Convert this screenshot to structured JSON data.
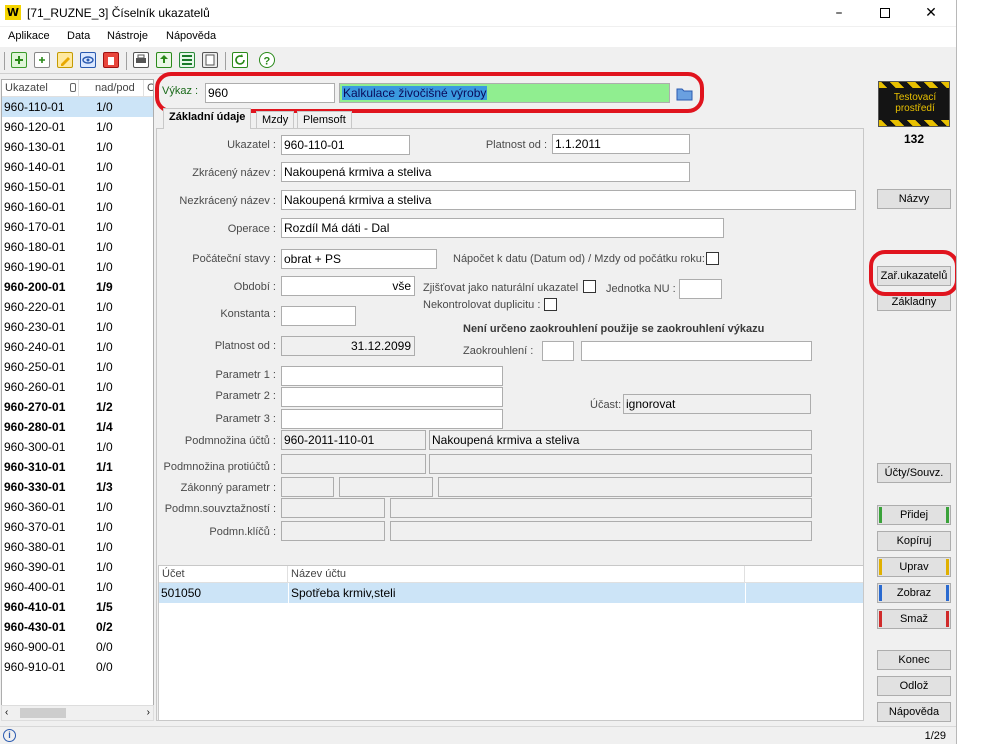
{
  "window": {
    "title": "[71_RUZNE_3] Číselník ukazatelů",
    "app_logo": "W"
  },
  "menu": [
    "Aplikace",
    "Data",
    "Nástroje",
    "Nápověda"
  ],
  "list": {
    "col1": "Ukazatel",
    "col2": "nad/pod",
    "col3": "C",
    "rows": [
      {
        "code": "960-110-01",
        "val": "1/0",
        "bold": false,
        "sel": true
      },
      {
        "code": "960-120-01",
        "val": "1/0",
        "bold": false
      },
      {
        "code": "960-130-01",
        "val": "1/0",
        "bold": false
      },
      {
        "code": "960-140-01",
        "val": "1/0",
        "bold": false
      },
      {
        "code": "960-150-01",
        "val": "1/0",
        "bold": false
      },
      {
        "code": "960-160-01",
        "val": "1/0",
        "bold": false
      },
      {
        "code": "960-170-01",
        "val": "1/0",
        "bold": false
      },
      {
        "code": "960-180-01",
        "val": "1/0",
        "bold": false
      },
      {
        "code": "960-190-01",
        "val": "1/0",
        "bold": false
      },
      {
        "code": "960-200-01",
        "val": "1/9",
        "bold": true
      },
      {
        "code": "960-220-01",
        "val": "1/0",
        "bold": false
      },
      {
        "code": "960-230-01",
        "val": "1/0",
        "bold": false
      },
      {
        "code": "960-240-01",
        "val": "1/0",
        "bold": false
      },
      {
        "code": "960-250-01",
        "val": "1/0",
        "bold": false
      },
      {
        "code": "960-260-01",
        "val": "1/0",
        "bold": false
      },
      {
        "code": "960-270-01",
        "val": "1/2",
        "bold": true
      },
      {
        "code": "960-280-01",
        "val": "1/4",
        "bold": true
      },
      {
        "code": "960-300-01",
        "val": "1/0",
        "bold": false
      },
      {
        "code": "960-310-01",
        "val": "1/1",
        "bold": true
      },
      {
        "code": "960-330-01",
        "val": "1/3",
        "bold": true
      },
      {
        "code": "960-360-01",
        "val": "1/0",
        "bold": false
      },
      {
        "code": "960-370-01",
        "val": "1/0",
        "bold": false
      },
      {
        "code": "960-380-01",
        "val": "1/0",
        "bold": false
      },
      {
        "code": "960-390-01",
        "val": "1/0",
        "bold": false
      },
      {
        "code": "960-400-01",
        "val": "1/0",
        "bold": false
      },
      {
        "code": "960-410-01",
        "val": "1/5",
        "bold": true
      },
      {
        "code": "960-430-01",
        "val": "0/2",
        "bold": true
      },
      {
        "code": "960-900-01",
        "val": "0/0",
        "bold": false
      },
      {
        "code": "960-910-01",
        "val": "0/0",
        "bold": false
      }
    ]
  },
  "vykaz": {
    "label": "Výkaz :",
    "code": "960",
    "name": "Kalkulace živočišné výroby"
  },
  "tabs": [
    "Základní údaje",
    "Mzdy",
    "Plemsoft"
  ],
  "form": {
    "ukazatel_lbl": "Ukazatel :",
    "ukazatel": "960-110-01",
    "platnost_od_lbl": "Platnost od :",
    "platnost_od": "1.1.2011",
    "zkraceny_lbl": "Zkrácený název :",
    "zkraceny": "Nakoupená krmiva a steliva",
    "nezkraceny_lbl": "Nezkrácený název :",
    "nezkraceny": "Nakoupená krmiva a steliva",
    "operace_lbl": "Operace :",
    "operace": "Rozdíl Má dáti - Dal",
    "pocatecni_lbl": "Počáteční stavy :",
    "pocatecni": "obrat + PS",
    "napocet_lbl": "Nápočet k datu (Datum od) / Mzdy od počátku roku:",
    "obdobi_lbl": "Období :",
    "obdobi": "vše",
    "zjistovat_lbl": "Zjišťovat jako naturální ukazatel",
    "jednotka_lbl": "Jednotka NU :",
    "nekontrolovat_lbl": "Nekontrolovat duplicitu :",
    "konstanta_lbl": "Konstanta :",
    "neni_urceno": "Není určeno zaokrouhlení použije se zaokrouhlení výkazu",
    "platnost_do_lbl": "Platnost od :",
    "platnost_do": "31.12.2099",
    "zaokrouhleni_lbl": "Zaokrouhlení :",
    "param1_lbl": "Parametr 1 :",
    "param2_lbl": "Parametr 2 :",
    "param3_lbl": "Parametr 3 :",
    "ucast_lbl": "Účast:",
    "ucast": "ignorovat",
    "podm_uctu_lbl": "Podmnožina účtů :",
    "podm_uctu_code": "960-2011-110-01",
    "podm_uctu_name": "Nakoupená krmiva a steliva",
    "podm_protiuctu_lbl": "Podmnožina protiúčtů :",
    "zakonny_lbl": "Zákonný parametr :",
    "souvztaznosti_lbl": "Podmn.souvztažností :",
    "klicu_lbl": "Podmn.klíčů :"
  },
  "grid": {
    "col1": "Účet",
    "col2": "Název účtu",
    "row": {
      "ucet": "501050",
      "nazev": "Spotřeba krmiv,steli"
    }
  },
  "side": {
    "badge_text": "Testovací prostředí",
    "count": "132",
    "buttons": {
      "nazvy": "Názvy",
      "zar": "Zař.ukazatelů",
      "zakladny": "Základny",
      "ucty": "Účty/Souvz.",
      "pridej": "Přidej",
      "kopiruj": "Kopíruj",
      "uprav": "Uprav",
      "zobraz": "Zobraz",
      "smaz": "Smaž",
      "konec": "Konec",
      "odloz": "Odlož",
      "napoveda": "Nápověda"
    }
  },
  "status": {
    "page": "1/29"
  },
  "colors": {
    "highlight": "#e0141e",
    "selection": "#cce4f7",
    "vykaz_name_bg": "#90ee90"
  }
}
